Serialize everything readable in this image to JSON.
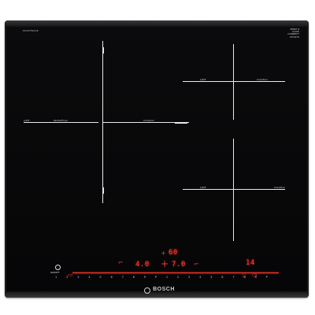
{
  "header": {
    "model": "PXV975DV1E",
    "brand_lines": [
      "SERIE 8",
      "COOK",
      "CONNECT",
      "PXV975"
    ]
  },
  "zones": {
    "left": {
      "left_label": "L/R/F",
      "right_label": "PerfectFryer",
      "mid_label": "Induction"
    },
    "top_right": {
      "left_label": "L/R/F",
      "right_label": "Induction"
    },
    "bottom_right": {
      "left_label": "L/R/F",
      "right_label": "Induction"
    }
  },
  "display": {
    "timer_main": "60",
    "left_value": "4.0",
    "center_value": "7.0",
    "right_value": "14"
  },
  "controls": {
    "power_label": "ON/OFF",
    "scale": [
      "1",
      "2",
      "3",
      "4",
      "5",
      "6",
      "7",
      "8",
      "9",
      "P",
      "1",
      "2",
      "3",
      "4",
      "5",
      "6",
      "7",
      "8",
      "9",
      "P"
    ]
  },
  "brand": "BOSCH"
}
